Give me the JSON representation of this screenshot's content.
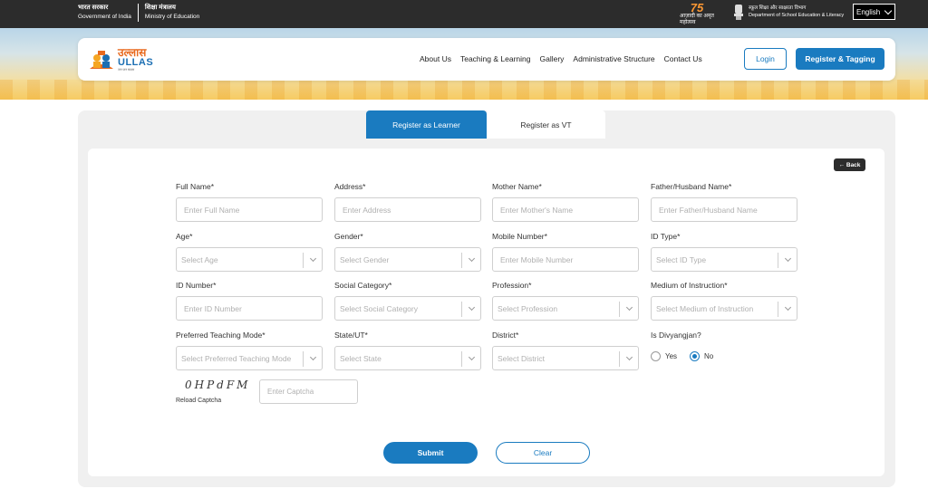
{
  "gov": {
    "india_hi": "भारत सरकार",
    "india_en": "Government of India",
    "ministry_hi": "शिक्षा मंत्रालय",
    "ministry_en": "Ministry of Education",
    "azadi_num": "75",
    "azadi_text": "आज़ादी का अमृत महोत्सव",
    "dept_hi": "स्कूल शिक्षा और साक्षरता विभाग",
    "dept_en": "Department of School Education & Literacy",
    "language": "English"
  },
  "logo": {
    "hindi": "उल्लास",
    "english": "ULLAS",
    "tagline": "जन जन साक्षर"
  },
  "nav": {
    "links": [
      "About Us",
      "Teaching & Learning",
      "Gallery",
      "Administrative Structure",
      "Contact Us"
    ],
    "login": "Login",
    "register": "Register & Tagging"
  },
  "tabs": {
    "learner": "Register as Learner",
    "vt": "Register as VT"
  },
  "back": "← Back",
  "fields": {
    "full_name": {
      "label": "Full Name*",
      "placeholder": "Enter Full Name"
    },
    "address": {
      "label": "Address*",
      "placeholder": "Enter Address"
    },
    "mother_name": {
      "label": "Mother Name*",
      "placeholder": "Enter Mother's Name"
    },
    "father_name": {
      "label": "Father/Husband Name*",
      "placeholder": "Enter Father/Husband Name"
    },
    "age": {
      "label": "Age*",
      "placeholder": "Select Age"
    },
    "gender": {
      "label": "Gender*",
      "placeholder": "Select Gender"
    },
    "mobile": {
      "label": "Mobile Number*",
      "placeholder": "Enter Mobile Number"
    },
    "id_type": {
      "label": "ID Type*",
      "placeholder": "Select ID Type"
    },
    "id_number": {
      "label": "ID Number*",
      "placeholder": "Enter ID Number"
    },
    "social_category": {
      "label": "Social Category*",
      "placeholder": "Select Social Category"
    },
    "profession": {
      "label": "Profession*",
      "placeholder": "Select Profession"
    },
    "medium": {
      "label": "Medium of Instruction*",
      "placeholder": "Select Medium of Instruction"
    },
    "teaching_mode": {
      "label": "Preferred Teaching Mode*",
      "placeholder": "Select Preferred Teaching Mode"
    },
    "state": {
      "label": "State/UT*",
      "placeholder": "Select State"
    },
    "district": {
      "label": "District*",
      "placeholder": "Select District"
    },
    "divyangjan": {
      "label": "Is Divyangjan?",
      "yes": "Yes",
      "no": "No",
      "selected": "No"
    }
  },
  "captcha": {
    "text": "0HPdFM",
    "reload": "Reload Captcha",
    "placeholder": "Enter Captcha"
  },
  "actions": {
    "submit": "Submit",
    "clear": "Clear"
  },
  "colors": {
    "primary": "#1a7bc0",
    "gov_bar": "#2c2c2c",
    "panel": "#f0f0f0"
  }
}
